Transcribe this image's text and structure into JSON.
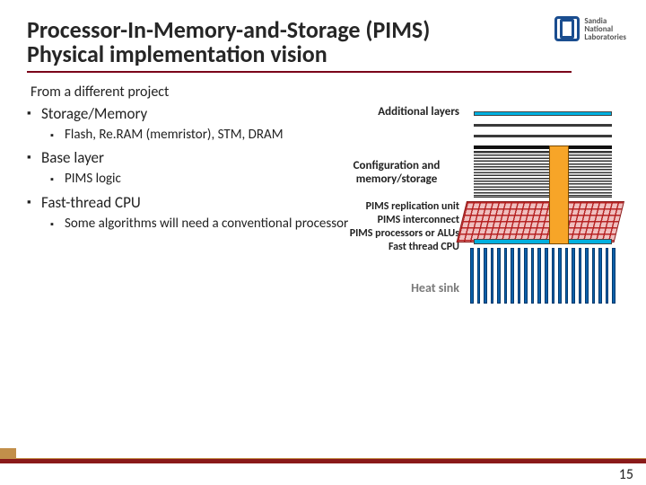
{
  "logo": {
    "line1": "Sandia",
    "line2": "National",
    "line3": "Laboratories"
  },
  "title_line1": "Processor-In-Memory-and-Storage (PIMS)",
  "title_line2": "Physical implementation vision",
  "subtitle": "From a different project",
  "bullets": {
    "l1a": "Storage/Memory",
    "l2a": "Flash, Re.RAM (memristor), STM, DRAM",
    "l1b": "Base layer",
    "l2b": "PIMS logic",
    "l1c": "Fast-thread CPU",
    "l2c": "Some algorithms will need a conventional processor"
  },
  "diagram": {
    "additional_layers": "Additional layers",
    "config": "Configuration and memory/storage",
    "repl": "PIMS replication unit",
    "interconnect": "PIMS interconnect",
    "alus": "PIMS processors or ALUs",
    "cpu": "Fast thread CPU",
    "heatsink": "Heat sink"
  },
  "page_number": "15"
}
